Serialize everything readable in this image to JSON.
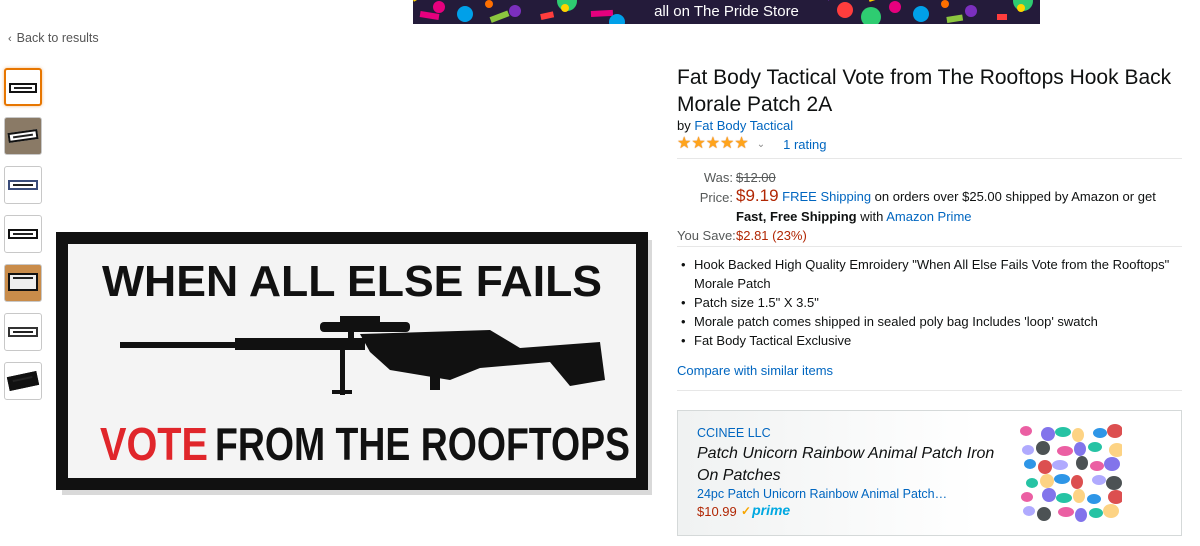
{
  "banner": {
    "text": "all on The Pride Store",
    "colors": [
      "#ffd400",
      "#e6007e",
      "#00a0e9",
      "#8cc63f",
      "#ff6f00",
      "#7b2fbe",
      "#ff3d3d",
      "#2ecc71"
    ]
  },
  "nav": {
    "back_label": "Back to results",
    "back_icon": "chevron-left-icon"
  },
  "gallery": {
    "thumbnail_count": 7,
    "selected_index": 0
  },
  "product": {
    "title": "Fat Body Tactical Vote from The Rooftops Hook Back Morale Patch 2A",
    "by_prefix": "by",
    "brand": "Fat Body Tactical",
    "stars": 5,
    "rating_count_label": "1 rating",
    "patch_text_top": "WHEN ALL ELSE FAILS",
    "patch_text_red": "VOTE",
    "patch_text_bottom": "FROM THE ROOFTOPS",
    "patch_colors": {
      "border": "#111111",
      "fabric": "#f4f4f4",
      "red": "#e0262b"
    }
  },
  "pricing": {
    "was_label": "Was:",
    "was_value": "$12.00",
    "price_label": "Price:",
    "price_value": "$9.19",
    "free_shipping": "FREE Shipping",
    "shipping_text_1": " on orders over $25.00 shipped by Amazon or get ",
    "fast_free": "Fast, Free Shipping",
    "with_text": " with ",
    "amazon_prime": "Amazon Prime",
    "save_label": "You Save:",
    "save_value": "$2.81 (23%)"
  },
  "features": [
    "Hook Backed High Quality Emroidery \"When All Else Fails Vote from the Rooftops\" Morale Patch",
    "Patch size 1.5\" X 3.5\"",
    "Morale patch comes shipped in sealed poly bag Includes 'loop' swatch",
    "Fat Body Tactical Exclusive"
  ],
  "compare_label": "Compare with similar items",
  "sponsored": {
    "brand": "CCINEE LLC",
    "headline": "Patch Unicorn Rainbow Animal Patch Iron On Patches",
    "product": "24pc Patch Unicorn Rainbow Animal Patch…",
    "price": "$10.99",
    "prime_label": "prime",
    "sticker_colors": [
      "#e84393",
      "#6c5ce7",
      "#00b894",
      "#fdcb6e",
      "#0984e3",
      "#d63031",
      "#a29bfe",
      "#2d3436"
    ]
  }
}
